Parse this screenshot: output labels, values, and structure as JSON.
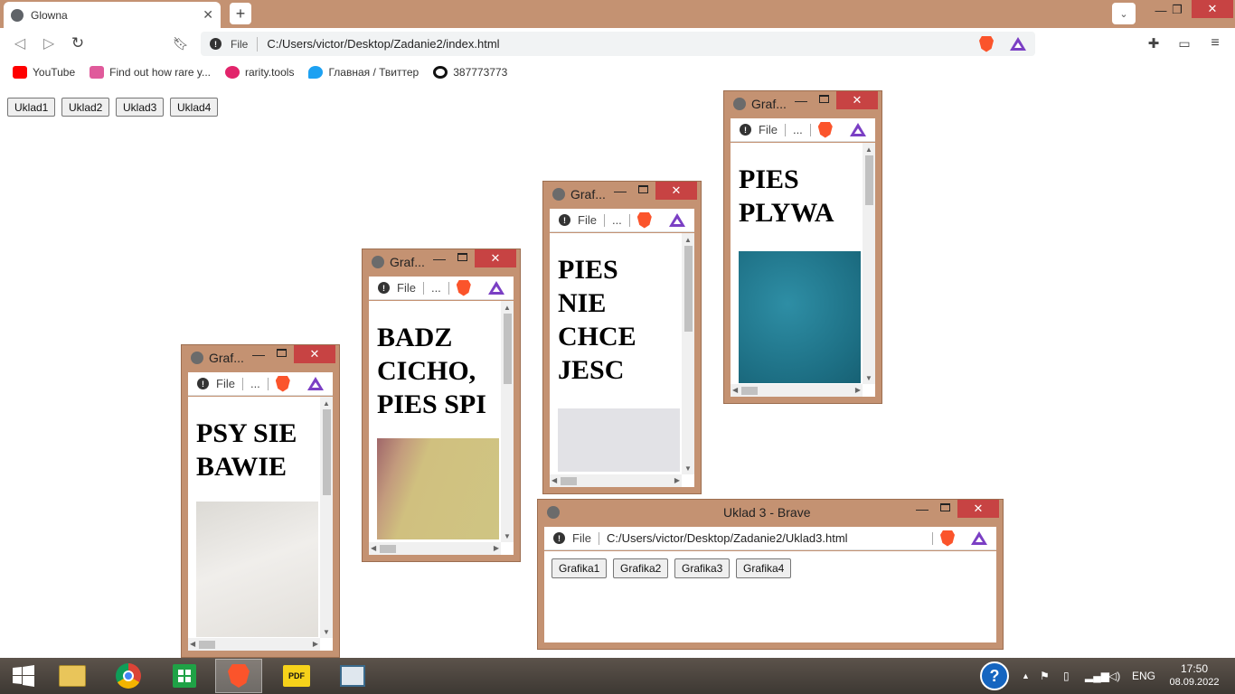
{
  "browser": {
    "tab_title": "Glowna",
    "tab_close": "✕",
    "new_tab": "+",
    "window_controls": {
      "minimize": "—",
      "maximize": "❐",
      "close": "✕",
      "tab_menu": "⌄"
    },
    "address": {
      "scheme_label": "File",
      "url": "C:/Users/victor/Desktop/Zadanie2/index.html"
    },
    "bookmarks": [
      {
        "label": "YouTube",
        "icon": "youtube-icon",
        "color": "#ff0000"
      },
      {
        "label": "Find out how rare y...",
        "icon": "rarity-icon",
        "color": "#e05a9b"
      },
      {
        "label": "rarity.tools",
        "icon": "rt-icon",
        "color": "#e2246b"
      },
      {
        "label": "Главная / Твиттер",
        "icon": "twitter-icon",
        "color": "#1da1f2"
      },
      {
        "label": "387773773",
        "icon": "link-icon",
        "color": "#111111"
      }
    ]
  },
  "page": {
    "buttons": [
      "Uklad1",
      "Uklad2",
      "Uklad3",
      "Uklad4"
    ]
  },
  "popups": [
    {
      "title": "Graf...",
      "scheme_label": "File",
      "more": "...",
      "heading": "PSY SIE BAWIE",
      "image_color": "#e8e6e2"
    },
    {
      "title": "Graf...",
      "scheme_label": "File",
      "more": "...",
      "heading": "BADZ CICHO, PIES SPI",
      "image_color": "#c9b776"
    },
    {
      "title": "Graf...",
      "scheme_label": "File",
      "more": "...",
      "heading": "PIES NIE CHCE JESC",
      "image_color": "#e2e2e6"
    },
    {
      "title": "Graf...",
      "scheme_label": "File",
      "more": "...",
      "heading": "PIES PLYWA",
      "image_color": "#23778d"
    }
  ],
  "uklad3_window": {
    "title": "Uklad 3 - Brave",
    "scheme_label": "File",
    "url": "C:/Users/victor/Desktop/Zadanie2/Uklad3.html",
    "buttons": [
      "Grafika1",
      "Grafika2",
      "Grafika3",
      "Grafika4"
    ]
  },
  "taskbar": {
    "language": "ENG",
    "time": "17:50",
    "date": "08.09.2022",
    "apps": [
      "windows-start",
      "file-explorer",
      "chrome",
      "store",
      "brave",
      "pdf-reader",
      "window-app"
    ]
  }
}
